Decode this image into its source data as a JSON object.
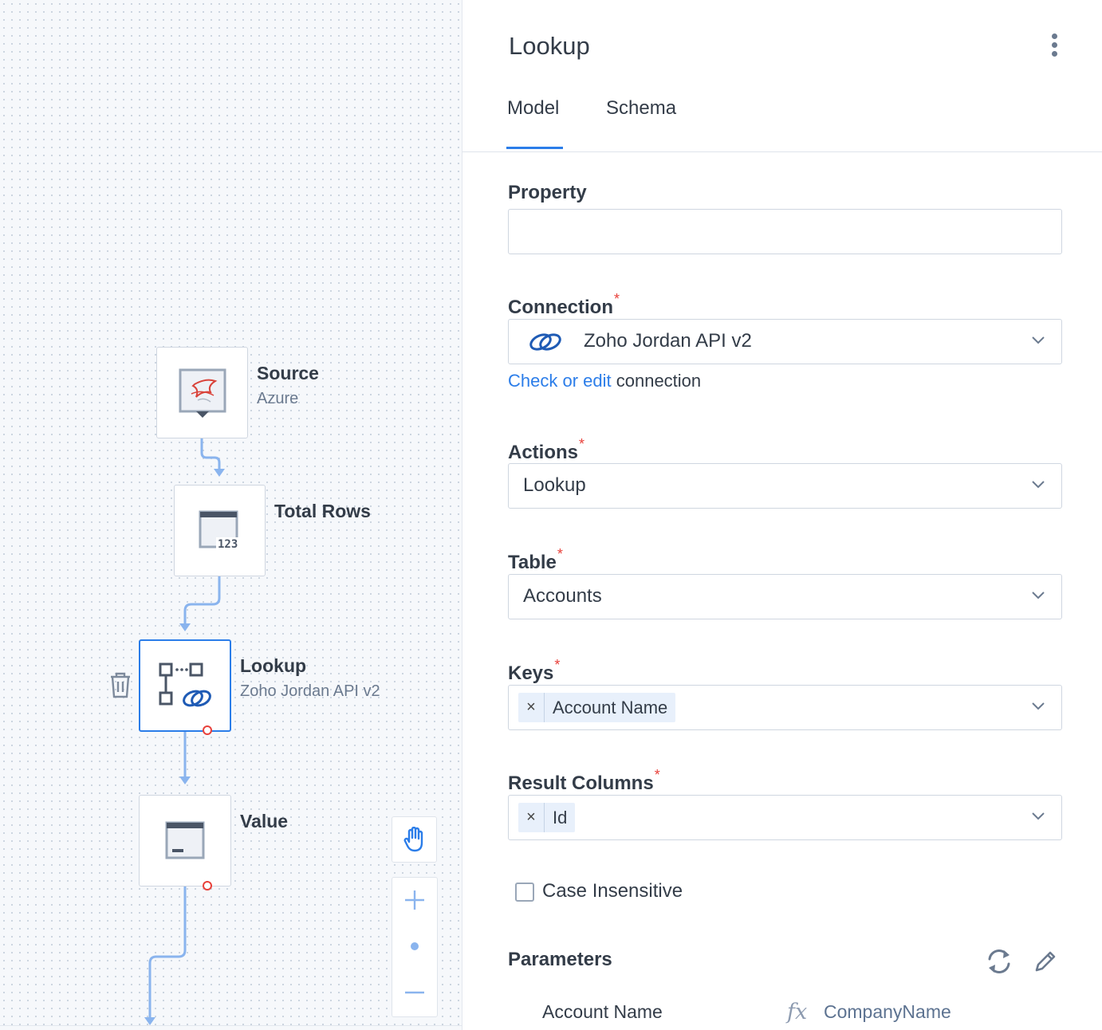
{
  "canvas": {
    "nodes": {
      "source": {
        "title": "Source",
        "subtitle": "Azure",
        "icon": "sql-server-icon"
      },
      "total_rows": {
        "title": "Total Rows",
        "icon": "row-count-icon"
      },
      "lookup": {
        "title": "Lookup",
        "subtitle": "Zoho Jordan API v2",
        "icon": "lookup-icon"
      },
      "value": {
        "title": "Value",
        "icon": "value-icon"
      }
    },
    "tools": [
      "hand-icon",
      "zoom-in-icon",
      "zoom-reset-icon",
      "zoom-out-icon"
    ]
  },
  "panel": {
    "title": "Lookup",
    "tabs": [
      {
        "label": "Model",
        "active": true
      },
      {
        "label": "Schema",
        "active": false
      }
    ],
    "property": {
      "label": "Property",
      "value": ""
    },
    "connection": {
      "label": "Connection",
      "required_mark": "*",
      "value": "Zoho Jordan API v2",
      "link_text": "Check or edit",
      "link_suffix": " connection"
    },
    "actions": {
      "label": "Actions",
      "required_mark": "*",
      "value": "Lookup"
    },
    "table": {
      "label": "Table",
      "required_mark": "*",
      "value": "Accounts"
    },
    "keys": {
      "label": "Keys",
      "required_mark": "*",
      "tags": [
        "Account Name"
      ],
      "remove_glyph": "×"
    },
    "result_columns": {
      "label": "Result Columns",
      "required_mark": "*",
      "tags": [
        "Id"
      ],
      "remove_glyph": "×"
    },
    "case_insensitive": {
      "label": "Case Insensitive",
      "checked": false
    },
    "parameters": {
      "label": "Parameters",
      "rows": [
        {
          "name": "Account Name",
          "fx": "fx",
          "value": "CompanyName"
        }
      ]
    }
  },
  "colors": {
    "accent": "#2b7de9",
    "required": "#e8403a",
    "text": "#333c48",
    "muted": "#6b7a8f"
  }
}
